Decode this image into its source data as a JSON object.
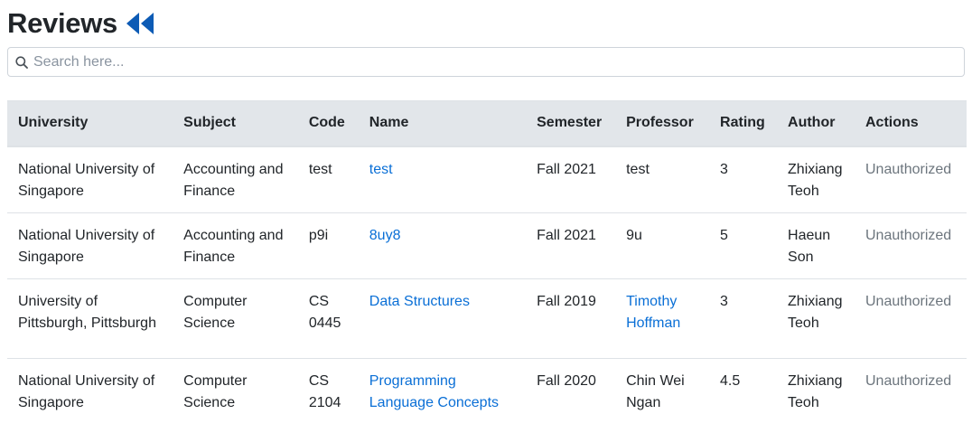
{
  "header": {
    "title": "Reviews",
    "back_icon": "double-chevron-left-icon",
    "accent": "#0d5bb5"
  },
  "search": {
    "placeholder": "Search here...",
    "value": "",
    "icon": "search-icon"
  },
  "table": {
    "columns": [
      "University",
      "Subject",
      "Code",
      "Name",
      "Semester",
      "Professor",
      "Rating",
      "Author",
      "Actions"
    ],
    "rows": [
      {
        "university": "National University of Singapore",
        "subject": "Accounting and Finance",
        "code": "test",
        "name": "test",
        "semester": "Fall 2021",
        "professor": "test",
        "professor_link": false,
        "rating": "3",
        "author": "Zhixiang Teoh",
        "actions": "Unauthorized"
      },
      {
        "university": "National University of Singapore",
        "subject": "Accounting and Finance",
        "code": "p9i",
        "name": "8uy8",
        "semester": "Fall 2021",
        "professor": "9u",
        "professor_link": false,
        "rating": "5",
        "author": "Haeun Son",
        "actions": "Unauthorized"
      },
      {
        "university": "University of Pittsburgh, Pittsburgh",
        "subject": "Computer Science",
        "code": "CS 0445",
        "name": "Data Structures",
        "semester": "Fall 2019",
        "professor": "Timothy Hoffman",
        "professor_link": true,
        "rating": "3",
        "author": "Zhixiang Teoh",
        "actions": "Unauthorized"
      },
      {
        "university": "National University of Singapore",
        "subject": "Computer Science",
        "code": "CS 2104",
        "name": "Programming Language Concepts",
        "semester": "Fall 2020",
        "professor": "Chin Wei Ngan",
        "professor_link": false,
        "rating": "4.5",
        "author": "Zhixiang Teoh",
        "actions": "Unauthorized"
      }
    ]
  }
}
